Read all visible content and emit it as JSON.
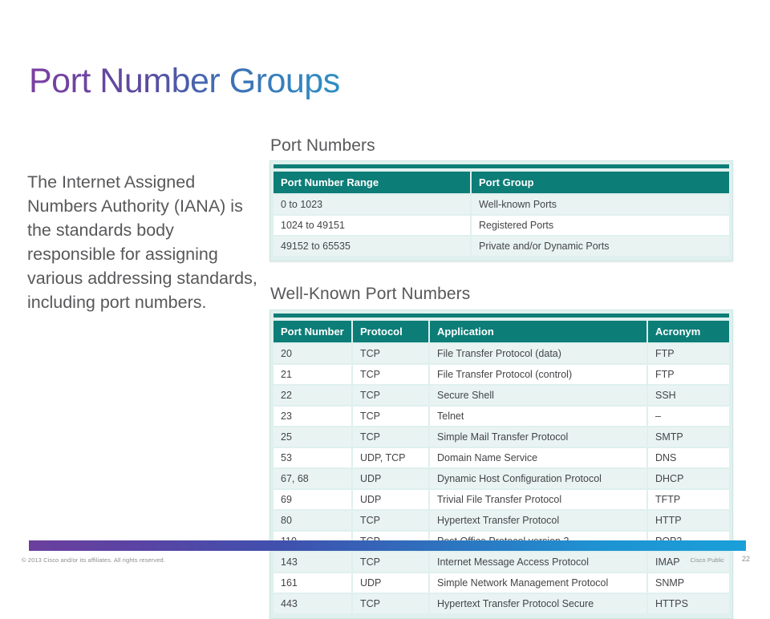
{
  "slide": {
    "title": "Port Number Groups",
    "body_text": "The Internet Assigned Numbers Authority (IANA) is the standards body responsible for assigning various addressing standards, including port numbers."
  },
  "port_groups_section": {
    "heading": "Port Numbers",
    "columns": [
      "Port Number Range",
      "Port Group"
    ],
    "rows": [
      [
        "0 to 1023",
        "Well-known Ports"
      ],
      [
        "1024 to 49151",
        "Registered Ports"
      ],
      [
        "49152 to 65535",
        "Private and/or Dynamic Ports"
      ]
    ]
  },
  "well_known_section": {
    "heading": "Well-Known Port Numbers",
    "columns": [
      "Port Number",
      "Protocol",
      "Application",
      "Acronym"
    ],
    "rows": [
      [
        "20",
        "TCP",
        "File Transfer Protocol (data)",
        "FTP"
      ],
      [
        "21",
        "TCP",
        "File Transfer Protocol (control)",
        "FTP"
      ],
      [
        "22",
        "TCP",
        "Secure Shell",
        "SSH"
      ],
      [
        "23",
        "TCP",
        "Telnet",
        "–"
      ],
      [
        "25",
        "TCP",
        "Simple Mail Transfer Protocol",
        "SMTP"
      ],
      [
        "53",
        "UDP, TCP",
        "Domain Name Service",
        "DNS"
      ],
      [
        "67, 68",
        "UDP",
        "Dynamic Host Configuration Protocol",
        "DHCP"
      ],
      [
        "69",
        "UDP",
        "Trivial File Transfer Protocol",
        "TFTP"
      ],
      [
        "80",
        "TCP",
        "Hypertext Transfer Protocol",
        "HTTP"
      ],
      [
        "110",
        "TCP",
        "Post Office Protocol version 3",
        "POP3"
      ],
      [
        "143",
        "TCP",
        "Internet Message Access Protocol",
        "IMAP"
      ],
      [
        "161",
        "UDP",
        "Simple Network Management Protocol",
        "SNMP"
      ],
      [
        "443",
        "TCP",
        "Hypertext Transfer Protocol Secure",
        "HTTPS"
      ]
    ]
  },
  "footer": {
    "copyright": "© 2013 Cisco and/or its affiliates. All rights reserved.",
    "classification": "Cisco Public",
    "page_number": "22"
  },
  "colors": {
    "table_header": "#0d7d77",
    "row_alt": "#e9f4f2",
    "frame": "#dff0ee",
    "text": "#58585b",
    "title_gradient_start": "#7b3fa0",
    "title_gradient_end": "#2e8fc4",
    "footer_bar_start": "#6b3f9e",
    "footer_bar_end": "#1a9fd9"
  }
}
